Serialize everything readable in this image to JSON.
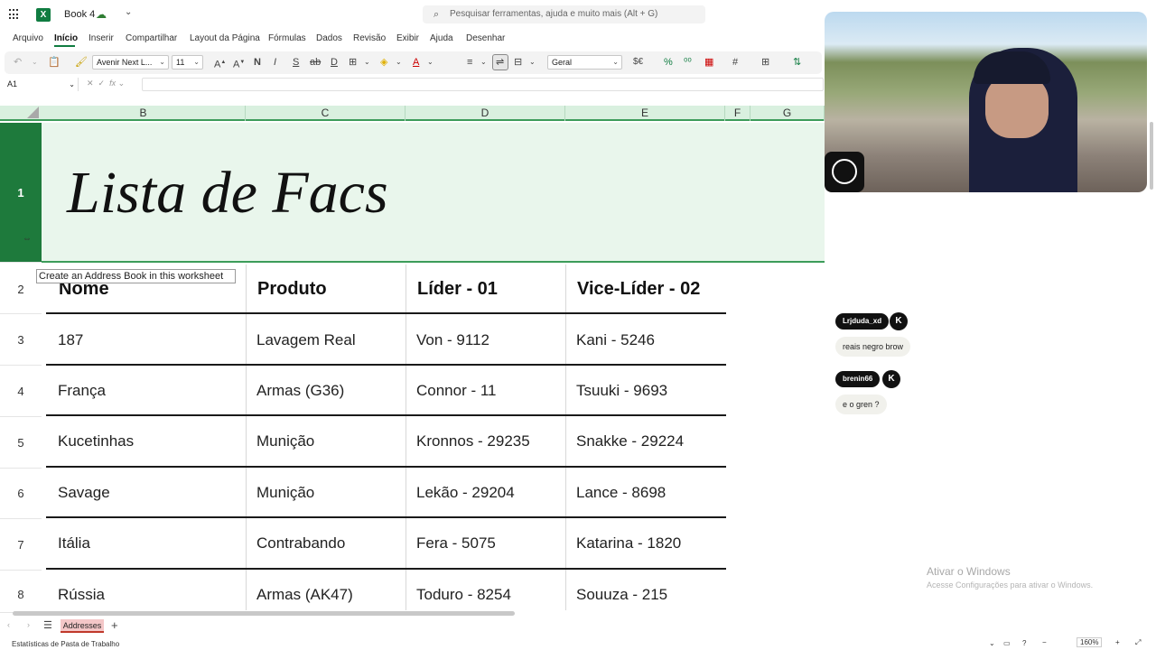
{
  "titlebar": {
    "doc_title": "Book 4",
    "search_placeholder": "Pesquisar ferramentas, ajuda e muito mais (Alt + G)"
  },
  "menu": [
    {
      "label": "Arquivo",
      "active": false
    },
    {
      "label": "Início",
      "active": true
    },
    {
      "label": "Inserir",
      "active": false
    },
    {
      "label": "Compartilhar",
      "active": false
    },
    {
      "label": "Layout da Página",
      "active": false
    },
    {
      "label": "Fórmulas",
      "active": false
    },
    {
      "label": "Dados",
      "active": false
    },
    {
      "label": "Revisão",
      "active": false
    },
    {
      "label": "Exibir",
      "active": false
    },
    {
      "label": "Ajuda",
      "active": false
    },
    {
      "label": "Desenhar",
      "active": false
    }
  ],
  "toolbar": {
    "font_name": "Avenir Next L...",
    "font_size": "11",
    "bold": "N",
    "italic": "I",
    "underline": "S",
    "number_format": "Geral",
    "currency": "$€"
  },
  "formula_bar": {
    "name_box": "A1",
    "fx": "fx"
  },
  "columns": [
    "B",
    "C",
    "D",
    "E",
    "F",
    "G"
  ],
  "rows": [
    "1",
    "2",
    "3",
    "4",
    "5",
    "6",
    "7",
    "8"
  ],
  "sheet": {
    "title": "Lista de Facs",
    "headers": [
      "Nome",
      "Produto",
      "Líder - 01",
      "Vice-Líder - 02"
    ],
    "data": [
      [
        "187",
        "Lavagem Real",
        "Von - 9112",
        "Kani - 5246"
      ],
      [
        "França",
        "Armas (G36)",
        "Connor - 11",
        "Tsuuki - 9693"
      ],
      [
        "Kucetinhas",
        "Munição",
        "Kronnos - 29235",
        "Snakke - 29224"
      ],
      [
        "Savage",
        "Munição",
        "Lekão - 29204",
        "Lance - 8698"
      ],
      [
        "Itália",
        "Contrabando",
        "Fera - 5075",
        "Katarina - 1820"
      ],
      [
        "Rússia",
        "Armas (AK47)",
        "Toduro - 8254",
        "Souuza - 215"
      ]
    ]
  },
  "tooltip": "Create an Address Book in this worksheet",
  "chat": [
    {
      "user": "Lrjduda_xd",
      "message": "reais negro brow"
    },
    {
      "user": "brenin66",
      "message": "e o gren ?"
    }
  ],
  "kick_badge": "K",
  "activation": {
    "line1": "Ativar o Windows",
    "line2": "Acesse Configurações para ativar o Windows."
  },
  "sheet_tabs": {
    "active": "Addresses"
  },
  "status": {
    "left": "Estatísticas de Pasta de Trabalho",
    "zoom": "160%"
  }
}
